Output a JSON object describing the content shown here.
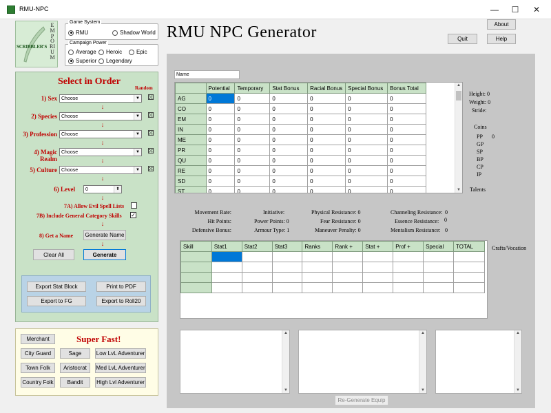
{
  "window": {
    "title": "RMU-NPC",
    "minimize": "—",
    "maximize": "☐",
    "close": "✕"
  },
  "logo": {
    "side_text": "SCRIBBLER'S",
    "vertical_text": "EMPORIUM"
  },
  "game_system": {
    "label": "Game System",
    "options": [
      {
        "label": "RMU",
        "selected": true
      },
      {
        "label": "Shadow World",
        "selected": false
      }
    ]
  },
  "campaign_power": {
    "label": "Campaign Power",
    "options": [
      {
        "label": "Average",
        "selected": false
      },
      {
        "label": "Heroic",
        "selected": false
      },
      {
        "label": "Epic",
        "selected": false
      },
      {
        "label": "Superior",
        "selected": true
      },
      {
        "label": "Legendary",
        "selected": false
      }
    ]
  },
  "header": {
    "title": "RMU NPC Generator",
    "about": "About",
    "quit": "Quit",
    "help": "Help"
  },
  "order_panel": {
    "title": "Select in Order",
    "random": "Random",
    "steps": [
      {
        "label": "1) Sex",
        "value": "Choose"
      },
      {
        "label": "2) Species",
        "value": "Choose"
      },
      {
        "label": "3) Profession",
        "value": "Choose"
      },
      {
        "label": "4) Magic Realm",
        "value": "Choose"
      },
      {
        "label": "5) Culture",
        "value": "Choose"
      }
    ],
    "level_label": "6) Level",
    "level_value": "0",
    "allow_evil_label": "7A) Allow Evil Spell Lists",
    "allow_evil_checked": false,
    "general_cat_label": "7B) Include General Category Skills",
    "general_cat_checked": true,
    "get_name_label": "8) Get a Name",
    "generate_name": "Generate Name",
    "clear_all": "Clear All",
    "generate": "Generate"
  },
  "export": {
    "stat_block": "Export Stat Block",
    "pdf": "Print to PDF",
    "fg": "Export to FG",
    "roll20": "Export to Roll20"
  },
  "super_fast": {
    "title": "Super Fast!",
    "buttons": [
      [
        "Merchant"
      ],
      [
        "City Guard",
        "Sage",
        "Low LvL Adventurer"
      ],
      [
        "Town Folk",
        "Aristocrat",
        "Med LvL Adventurer"
      ],
      [
        "Country Folk",
        "Bandit",
        "High Lvl Adventurer"
      ]
    ]
  },
  "name_field": {
    "value": "Name"
  },
  "stats": {
    "headers": [
      "",
      "Potential",
      "Temporary",
      "Stat Bonus",
      "Racial Bonus",
      "Special Bonus",
      "Bonus Total"
    ],
    "rows": [
      [
        "AG",
        "0",
        "0",
        "0",
        "0",
        "0",
        "0"
      ],
      [
        "CO",
        "0",
        "0",
        "0",
        "0",
        "0",
        "0"
      ],
      [
        "EM",
        "0",
        "0",
        "0",
        "0",
        "0",
        "0"
      ],
      [
        "IN",
        "0",
        "0",
        "0",
        "0",
        "0",
        "0"
      ],
      [
        "ME",
        "0",
        "0",
        "0",
        "0",
        "0",
        "0"
      ],
      [
        "PR",
        "0",
        "0",
        "0",
        "0",
        "0",
        "0"
      ],
      [
        "QU",
        "0",
        "0",
        "0",
        "0",
        "0",
        "0"
      ],
      [
        "RE",
        "0",
        "0",
        "0",
        "0",
        "0",
        "0"
      ],
      [
        "SD",
        "0",
        "0",
        "0",
        "0",
        "0",
        "0"
      ],
      [
        "ST",
        "0",
        "0",
        "0",
        "0",
        "0",
        "0"
      ]
    ]
  },
  "physical": {
    "height": "Height: 0",
    "weight": "Weight: 0",
    "stride": "Stride:"
  },
  "coins": {
    "title": "Coins",
    "items": [
      {
        "label": "PP",
        "value": "0"
      },
      {
        "label": "GP",
        "value": ""
      },
      {
        "label": "SP",
        "value": ""
      },
      {
        "label": "BP",
        "value": ""
      },
      {
        "label": "CP",
        "value": ""
      },
      {
        "label": "IP",
        "value": ""
      }
    ]
  },
  "talents": "Talents",
  "info": {
    "movement": "Movement Rate:",
    "hit_points": "Hit Points:",
    "defensive": "Defensive Bonus:",
    "initiative": "Initiative:",
    "power_points": "Power Points: 0",
    "armour": "Armour Type: 1",
    "phys_res": "Physical Resistance: 0",
    "fear_res": "Fear Resistance: 0",
    "maneuver": "Maneuver Penalty: 0",
    "chan_res": "Channeling Resistance:",
    "chan_val": "0",
    "ess_res": "Essence Resistance:",
    "ess_val": "0",
    "ment_res": "Mentalism Resistance:",
    "ment_val": "0"
  },
  "skills": {
    "headers": [
      "Skill",
      "Stat1",
      "Stat2",
      "Stat3",
      "Ranks",
      "Rank +",
      "Stat +",
      "Prof +",
      "Special",
      "TOTAL"
    ]
  },
  "crafts": "Crafts/Vocation",
  "regen_equip": "Re-Generate Equip",
  "colors": {
    "green": "#c9e2c7",
    "red": "#c00000",
    "panel": "#c6c6c6",
    "yellow": "#fffde6"
  }
}
